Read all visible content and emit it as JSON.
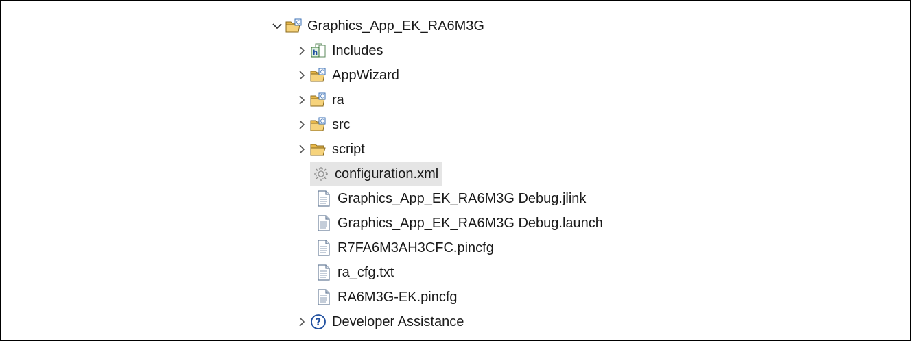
{
  "project": {
    "name": "Graphics_App_EK_RA6M3G",
    "icon": "project-folder-icon",
    "expanded": true
  },
  "items": [
    {
      "label": "Includes",
      "icon": "includes-icon",
      "expandable": true
    },
    {
      "label": "AppWizard",
      "icon": "source-folder-icon",
      "expandable": true
    },
    {
      "label": "ra",
      "icon": "source-folder-icon",
      "expandable": true
    },
    {
      "label": "src",
      "icon": "source-folder-icon",
      "expandable": true
    },
    {
      "label": "script",
      "icon": "folder-icon",
      "expandable": true
    },
    {
      "label": "configuration.xml",
      "icon": "gear-file-icon",
      "expandable": false,
      "selected": true
    },
    {
      "label": "Graphics_App_EK_RA6M3G Debug.jlink",
      "icon": "text-file-icon",
      "expandable": false
    },
    {
      "label": "Graphics_App_EK_RA6M3G Debug.launch",
      "icon": "text-file-icon",
      "expandable": false
    },
    {
      "label": "R7FA6M3AH3CFC.pincfg",
      "icon": "text-file-icon",
      "expandable": false
    },
    {
      "label": "ra_cfg.txt",
      "icon": "text-file-icon",
      "expandable": false
    },
    {
      "label": "RA6M3G-EK.pincfg",
      "icon": "text-file-icon",
      "expandable": false
    },
    {
      "label": "Developer Assistance",
      "icon": "help-icon",
      "expandable": true
    }
  ],
  "colors": {
    "selection": "#e5e5e5",
    "folder": "#e8b84a",
    "border": "#000000"
  }
}
